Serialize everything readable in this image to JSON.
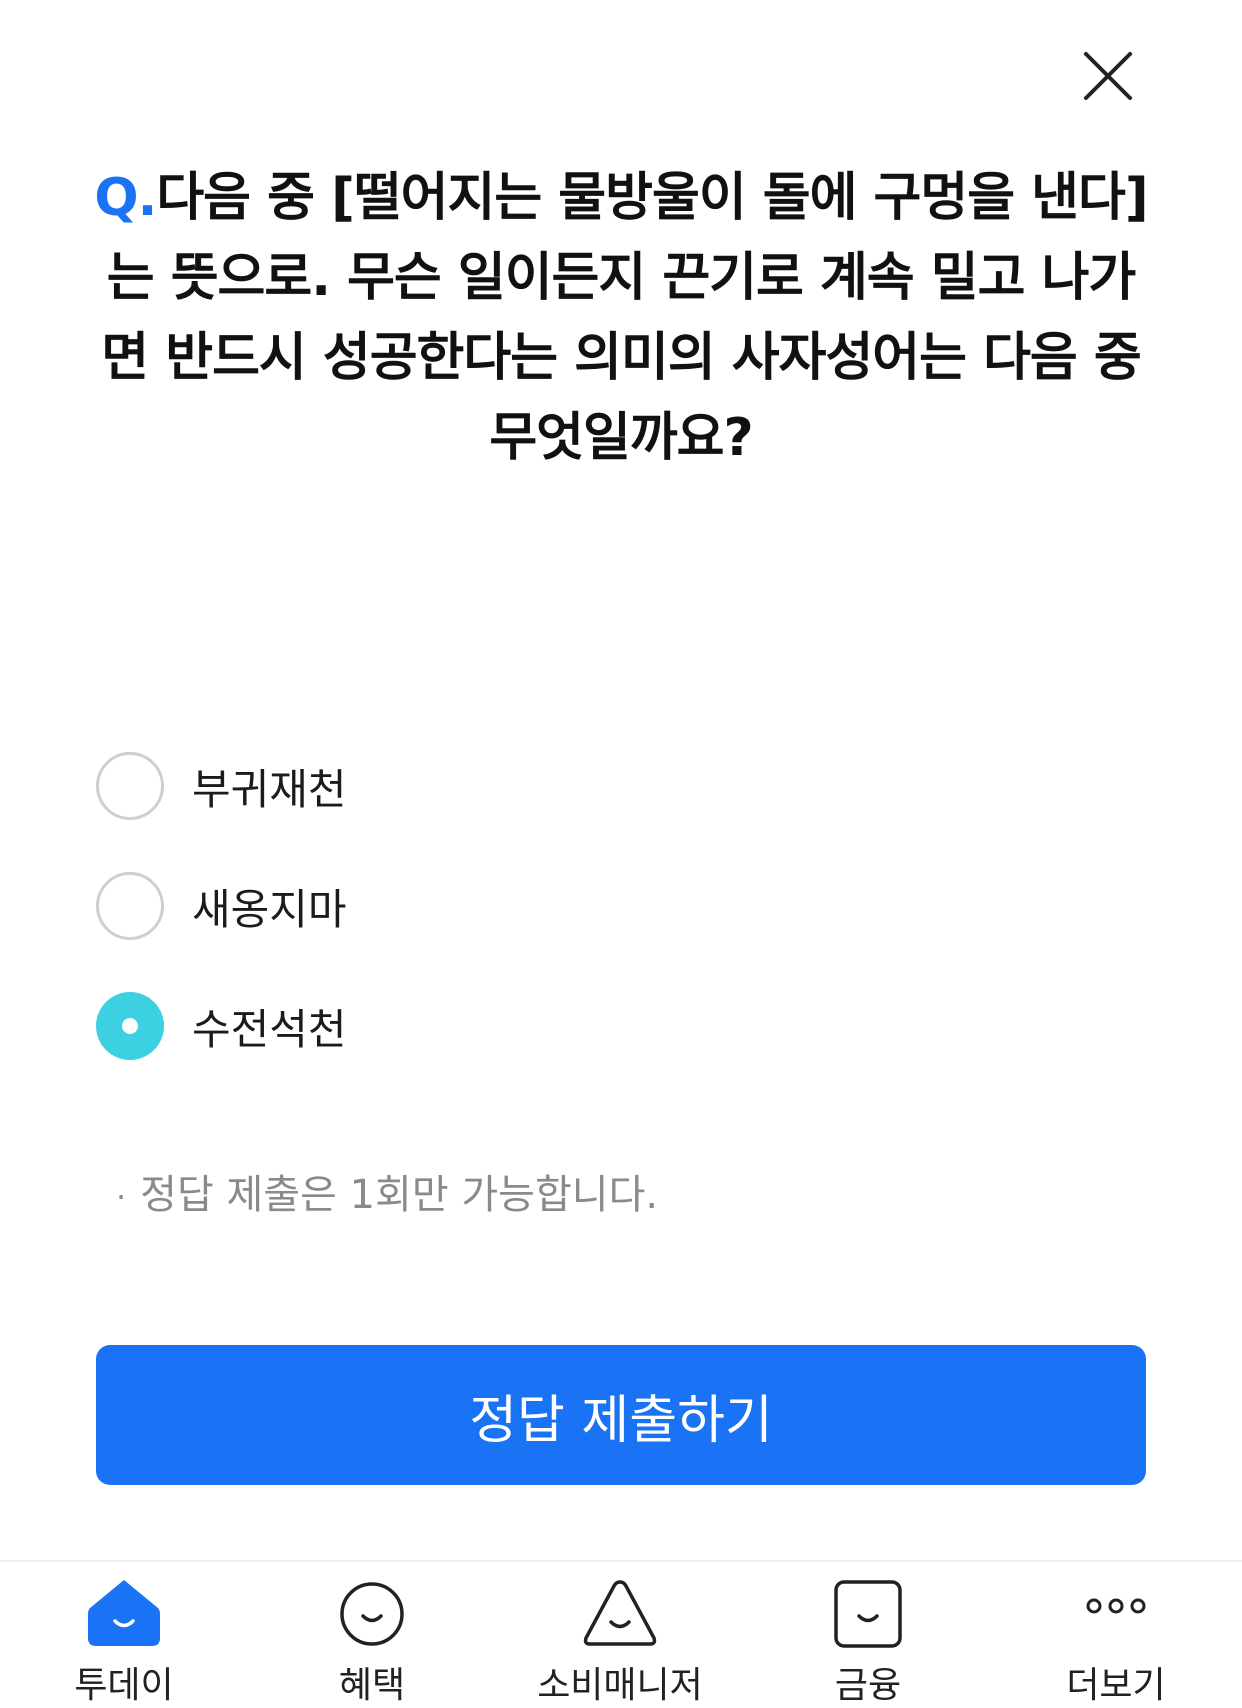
{
  "question": {
    "prefix": "Q.",
    "text": "다음 중 [떨어지는 물방울이 돌에 구멍을 낸다]는 뜻으로. 무슨 일이든지 끈기로 계속 밀고 나가면 반드시 성공한다는 의미의 사자성어는 다음 중 무엇일까요?"
  },
  "options": [
    {
      "label": "부귀재천",
      "selected": false
    },
    {
      "label": "새옹지마",
      "selected": false
    },
    {
      "label": "수전석천",
      "selected": true
    }
  ],
  "notice": {
    "bullet": "·",
    "text": "정답 제출은 1회만 가능합니다."
  },
  "submit": {
    "label": "정답 제출하기"
  },
  "tabbar": {
    "items": [
      {
        "label": "투데이",
        "icon": "home-smile-icon",
        "active": true
      },
      {
        "label": "혜택",
        "icon": "smile-circle-icon",
        "active": false
      },
      {
        "label": "소비매니저",
        "icon": "smile-triangle-icon",
        "active": false
      },
      {
        "label": "금융",
        "icon": "smile-square-icon",
        "active": false
      },
      {
        "label": "더보기",
        "icon": "more-dots-icon",
        "active": false
      }
    ]
  },
  "colors": {
    "accent": "#1a73f5",
    "selected_radio": "#3dd0e3",
    "notice_text": "#8a8a8a"
  }
}
